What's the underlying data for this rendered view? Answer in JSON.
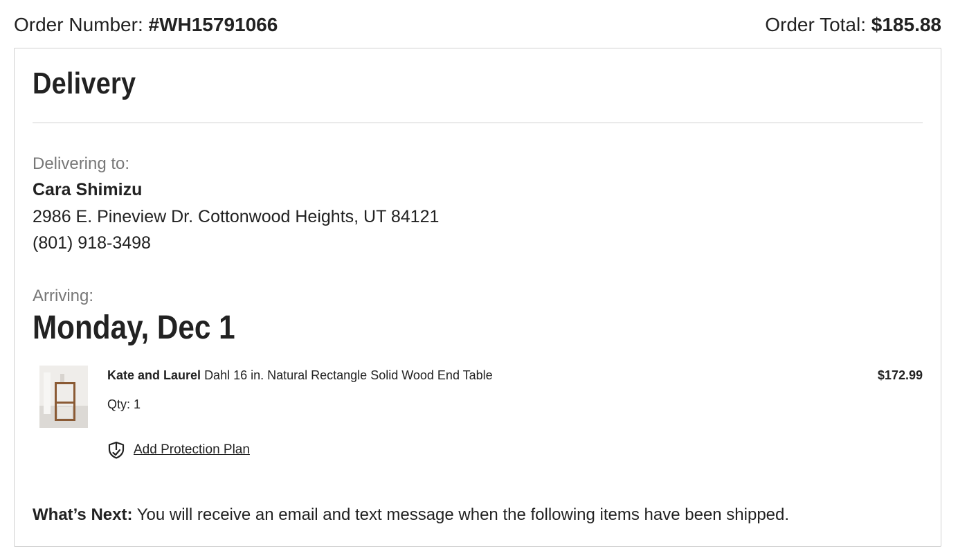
{
  "order": {
    "number_label": "Order Number:",
    "number_value": "#WH15791066",
    "total_label": "Order Total:",
    "total_value": "$185.88"
  },
  "delivery": {
    "title": "Delivery",
    "delivering_to_label": "Delivering to:",
    "recipient_name": "Cara Shimizu",
    "address": "2986 E. Pineview Dr. Cottonwood Heights, UT 84121",
    "phone": "(801) 918-3498",
    "arriving_label": "Arriving:",
    "arrival_date": "Monday, Dec 1"
  },
  "item": {
    "brand": "Kate and Laurel",
    "name": "Dahl 16 in. Natural Rectangle Solid Wood End Table",
    "qty": "Qty: 1",
    "price": "$172.99",
    "protection_label": "Add Protection Plan",
    "protection_icon": "shield-icon"
  },
  "whats_next": {
    "label": "What’s Next:",
    "text": "You will receive an email and text message when the following items have been shipped."
  }
}
